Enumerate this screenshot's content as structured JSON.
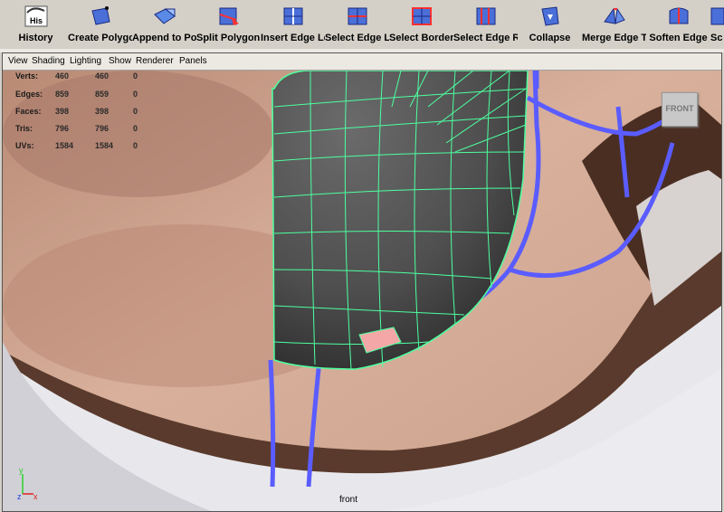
{
  "shelf": {
    "tools": [
      {
        "label": "History",
        "icon": "history-icon",
        "badge": "His"
      },
      {
        "label": "Create Polygon Tool",
        "icon": "create-polygon-icon"
      },
      {
        "label": "Append to Polygon Tool",
        "icon": "append-polygon-icon"
      },
      {
        "label": "Split Polygon Tool",
        "icon": "split-polygon-icon"
      },
      {
        "label": "Insert Edge Loop Tool",
        "icon": "insert-edge-loop-icon"
      },
      {
        "label": "Select Edge Loop",
        "icon": "select-edge-loop-icon"
      },
      {
        "label": "Select Border Edge",
        "icon": "select-border-edge-icon"
      },
      {
        "label": "Select Edge Ring",
        "icon": "select-edge-ring-icon"
      },
      {
        "label": "Collapse",
        "icon": "collapse-icon"
      },
      {
        "label": "Merge Edge Tool",
        "icon": "merge-edge-icon"
      },
      {
        "label": "Soften Edge",
        "icon": "soften-edge-icon"
      },
      {
        "label": "Sc",
        "icon": "sculpt-icon"
      }
    ]
  },
  "panel_menu": [
    "View",
    "Shading",
    "Lighting",
    "Show",
    "Renderer",
    "Panels"
  ],
  "hud": {
    "rows": [
      {
        "label": "Verts:",
        "a": "460",
        "b": "460",
        "c": "0"
      },
      {
        "label": "Edges:",
        "a": "859",
        "b": "859",
        "c": "0"
      },
      {
        "label": "Faces:",
        "a": "398",
        "b": "398",
        "c": "0"
      },
      {
        "label": "Tris:",
        "a": "796",
        "b": "796",
        "c": "0"
      },
      {
        "label": "UVs:",
        "a": "1584",
        "b": "1584",
        "c": "0"
      }
    ]
  },
  "camera_label": "front",
  "view_cube_label": "FRONT",
  "axis": {
    "y": "y",
    "z": "z",
    "x": "x"
  },
  "colors": {
    "wire": "#4dff9f",
    "selection": "#f3a7a7",
    "curves": "#5a5cff",
    "mesh": "#585858"
  }
}
